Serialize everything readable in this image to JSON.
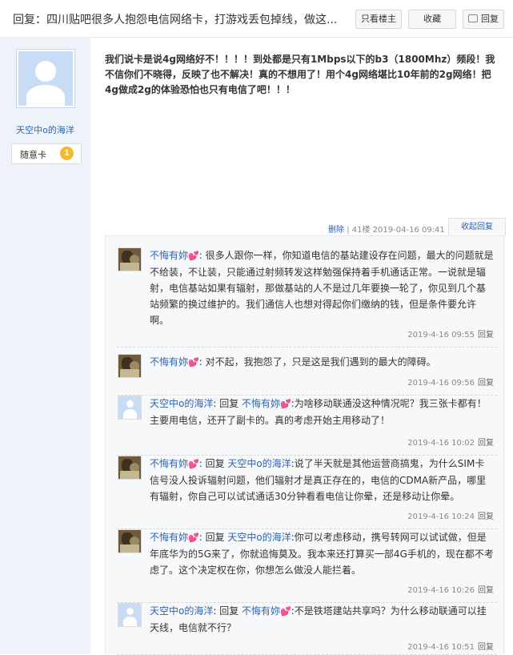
{
  "header": {
    "title": "回复：四川贴吧很多人抱怨电信网络卡，打游戏丢包掉线，做这...",
    "only_op": "只看楼主",
    "favorite": "收藏",
    "reply": "回复"
  },
  "author": {
    "name": "天空中o的海洋",
    "badge": "随意卡",
    "level": "1"
  },
  "post": {
    "content": "我们说卡是说4g网络好不！！！！到处都是只有1Mbps以下的b3（1800Mhz）频段！我不信你们不晓得，反映了也不解决！真的不想用了！用个4g网络堪比10年前的2g网络！把4g做成2g的体验恐怕也只有电信了吧！！！",
    "delete": "删除",
    "floor": "41楼",
    "time": "2019-04-16 09:41",
    "collapse": "收起回复"
  },
  "replies": [
    {
      "avatar": "dog-avatar",
      "user": "不悔有妳",
      "heart": "💕",
      "reply_prefix": "",
      "reply_to": "",
      "text": ": 很多人跟你一样，你知道电信的基站建设存在问题，最大的问题就是不给装，不让装，只能通过射频转发这样勉强保持着手机通话正常。一说就是辐射，电信基站如果有辐射，那做基站的人不是过几年要换一轮了，你见到几个基站频繁的换过维护的。我们通信人也想对得起你们缴纳的钱，但是条件要允许啊。",
      "time": "2019-4-16 09:55",
      "reply_label": "回复"
    },
    {
      "avatar": "dog-avatar",
      "user": "不悔有妳",
      "heart": "💕",
      "reply_prefix": "",
      "reply_to": "",
      "text": ": 对不起，我抱怨了，只是这是我们遇到的最大的障碍。",
      "time": "2019-4-16 09:56",
      "reply_label": "回复"
    },
    {
      "avatar": "default-avatar",
      "user": "天空中o的海洋",
      "heart": "",
      "reply_prefix": ": 回复 ",
      "reply_to": "不悔有妳",
      "text": ":为啥移动联通没这种情况呢？我三张卡都有！主要用电信，还开了副卡的。真的考虑开始主用移动了！",
      "time": "2019-4-16 10:02",
      "reply_label": "回复"
    },
    {
      "avatar": "dog-avatar",
      "user": "不悔有妳",
      "heart": "💕",
      "reply_prefix": ": 回复 ",
      "reply_to": "天空中o的海洋",
      "text": ":说了半天就是其他运营商搞鬼，为什么SIM卡信号没人投诉辐射问题，他们辐射才是真正存在的，电信的CDMA新产品，哪里有辐射，你自己可以试试通话30分钟看看电信让你晕，还是移动让你晕。",
      "time": "2019-4-16 10:24",
      "reply_label": "回复"
    },
    {
      "avatar": "dog-avatar",
      "user": "不悔有妳",
      "heart": "💕",
      "reply_prefix": ": 回复 ",
      "reply_to": "天空中o的海洋",
      "text": ":你可以考虑移动，携号转网可以试试做，但是年底华为的5G来了，你就追悔莫及。我本来还打算买一部4G手机的，现在都不考虑了。这个决定权在你，你想怎么做没人能拦着。",
      "time": "2019-4-16 10:26",
      "reply_label": "回复"
    },
    {
      "avatar": "default-avatar",
      "user": "天空中o的海洋",
      "heart": "",
      "reply_prefix": ": 回复 ",
      "reply_to": "不悔有妳",
      "text": ":不是铁塔建站共享吗？为什么移动联通可以挂天线，电信就不行？",
      "time": "2019-4-16 10:51",
      "reply_label": "回复"
    }
  ]
}
